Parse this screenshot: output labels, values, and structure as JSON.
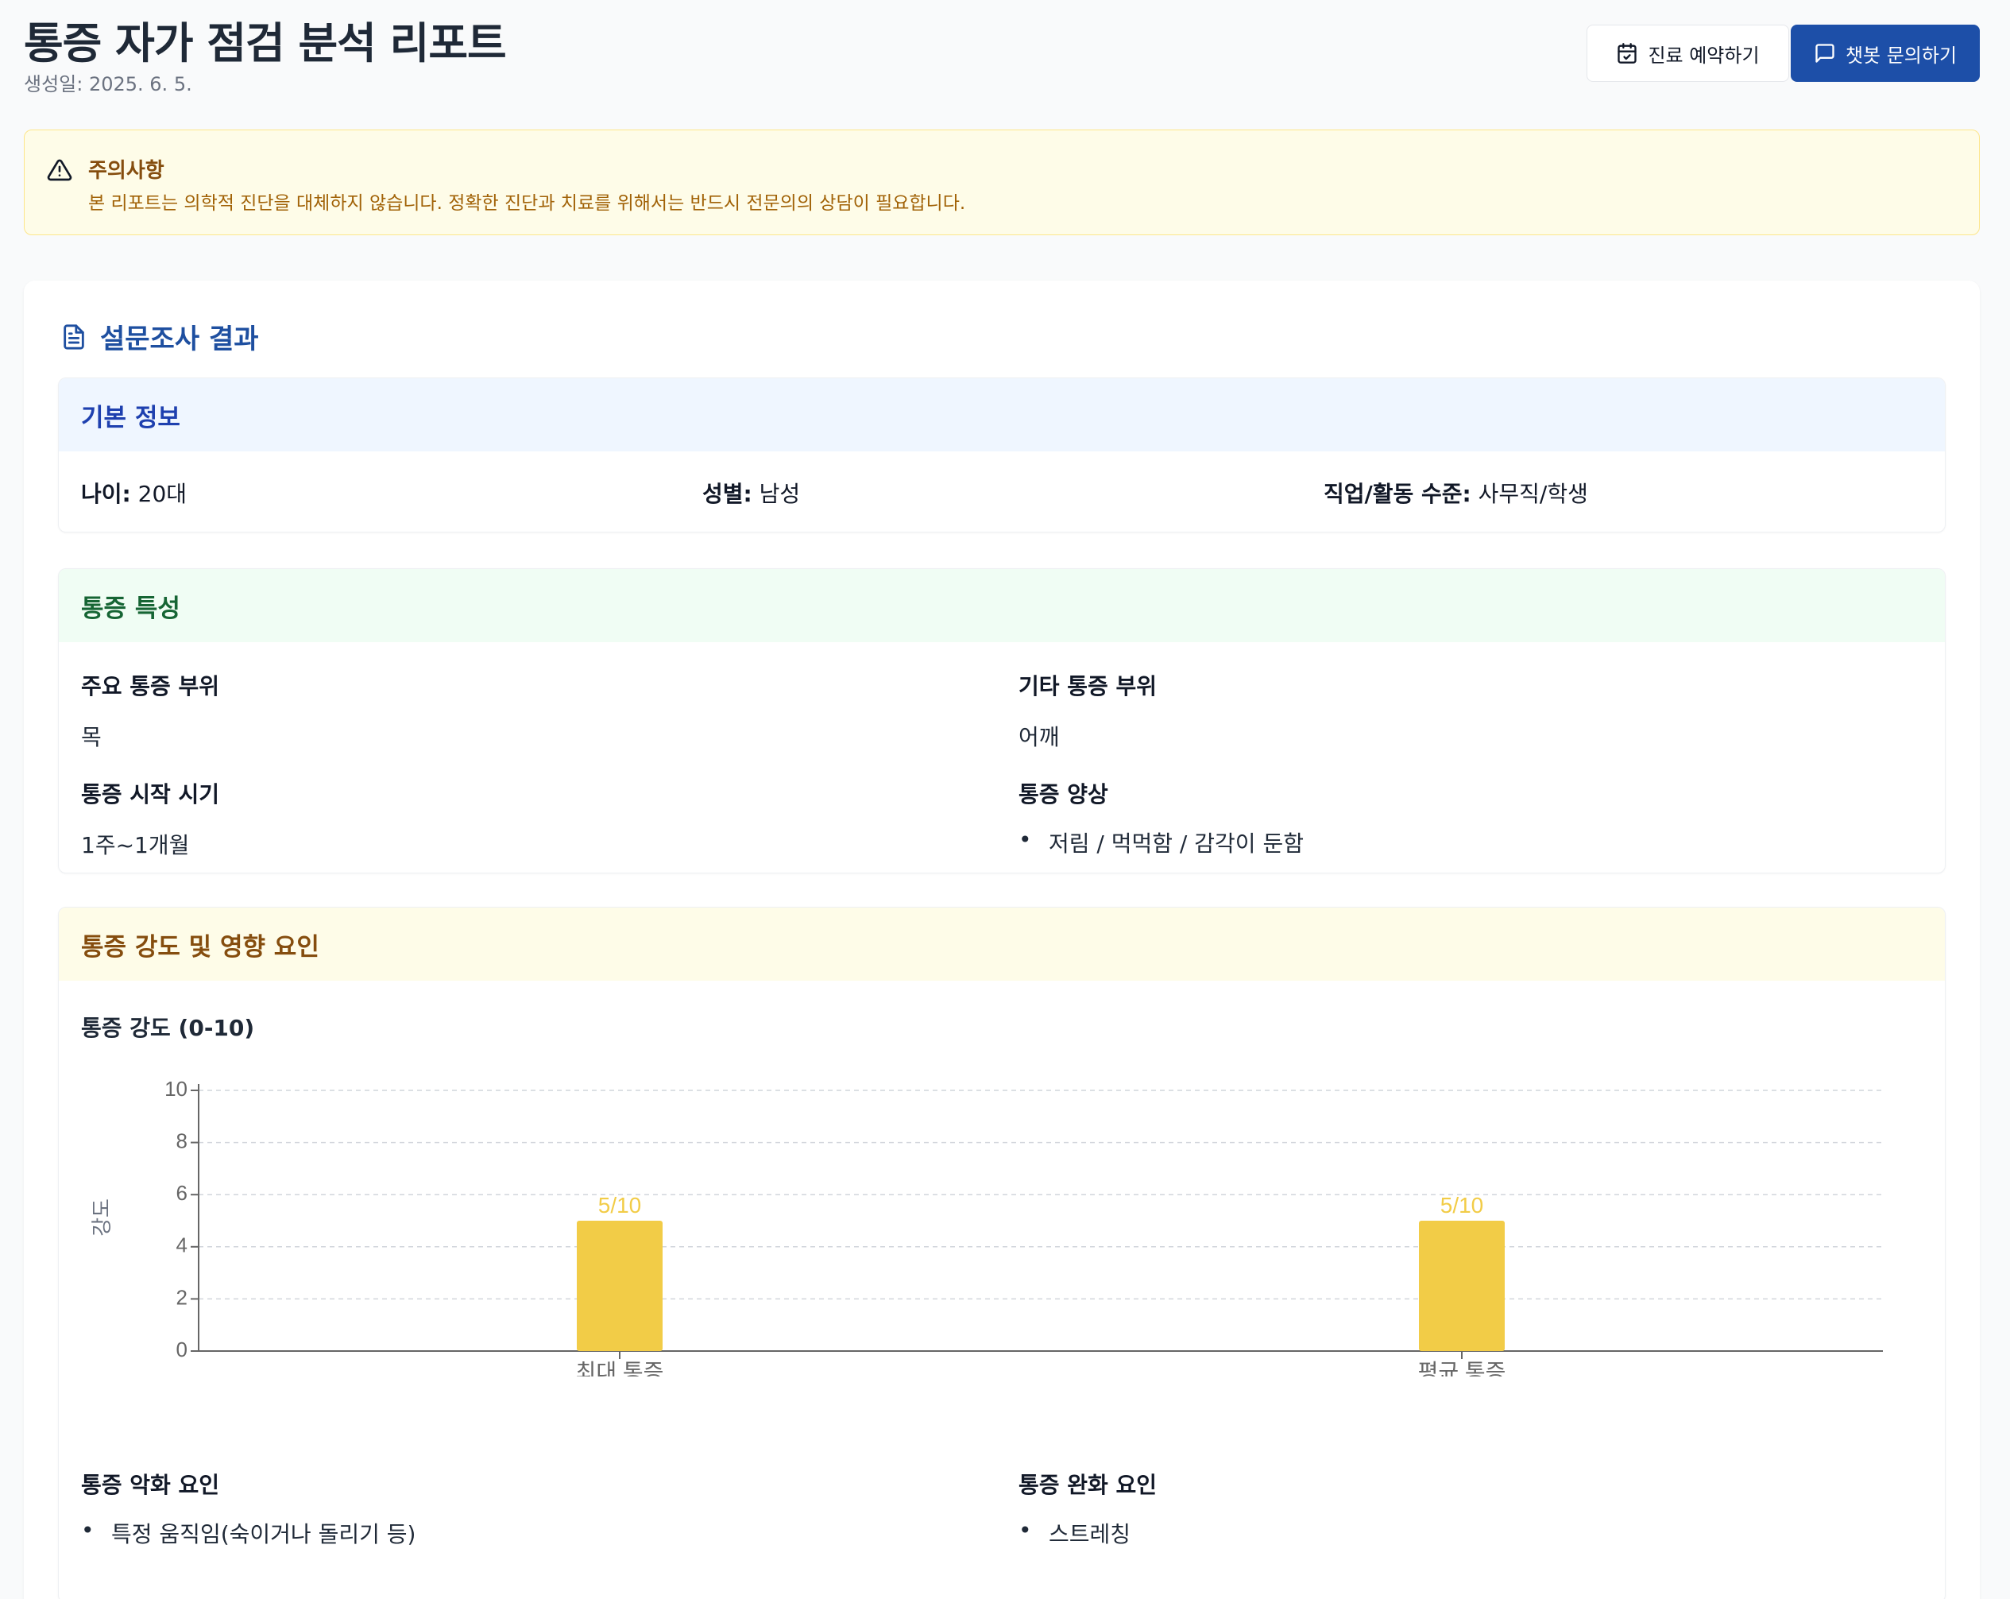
{
  "header": {
    "title": "통증 자가 점검 분석 리포트",
    "date": "생성일: 2025. 6. 5.",
    "book_button": "진료 예약하기",
    "chat_button": "챗봇 문의하기"
  },
  "warning": {
    "title": "주의사항",
    "text": "본 리포트는 의학적 진단을 대체하지 않습니다. 정확한 진단과 치료를 위해서는 반드시 전문의의 상담이 필요합니다."
  },
  "survey": {
    "title": "설문조사 결과",
    "basic": {
      "title": "기본 정보",
      "age_label": "나이:",
      "age_value": "20대",
      "gender_label": "성별:",
      "gender_value": "남성",
      "job_label": "직업/활동 수준:",
      "job_value": "사무직/학생"
    },
    "characteristics": {
      "title": "통증 특성",
      "main_area_label": "주요 통증 부위",
      "main_area_value": "목",
      "other_area_label": "기타 통증 부위",
      "other_area_value": "어깨",
      "onset_label": "통증 시작 시기",
      "onset_value": "1주~1개월",
      "pattern_label": "통증 양상",
      "pattern_items": [
        "저림 / 먹먹함 / 감각이 둔함"
      ]
    },
    "intensity": {
      "title": "통증 강도 및 영향 요인",
      "chart_title": "통증 강도 (0-10)",
      "aggravating_label": "통증 악화 요인",
      "aggravating_items": [
        "특정 움직임(숙이거나 돌리기 등)"
      ],
      "relieving_label": "통증 완화 요인",
      "relieving_items": [
        "스트레칭"
      ]
    }
  },
  "chart_data": {
    "type": "bar",
    "title": "통증 강도 (0-10)",
    "categories": [
      "최대 통증",
      "평균 통증"
    ],
    "values": [
      5,
      5
    ],
    "data_labels": [
      "5/10",
      "5/10"
    ],
    "ylabel": "강도",
    "xlabel": "",
    "ylim": [
      0,
      10
    ],
    "yticks": [
      0,
      2,
      4,
      6,
      8,
      10
    ],
    "grid": true,
    "bar_color": "#f2cc47"
  },
  "colors": {
    "primary": "#1d4fa8",
    "warning_bg": "#fefce8",
    "warning_text": "#a16207",
    "bar": "#f2cc47"
  }
}
